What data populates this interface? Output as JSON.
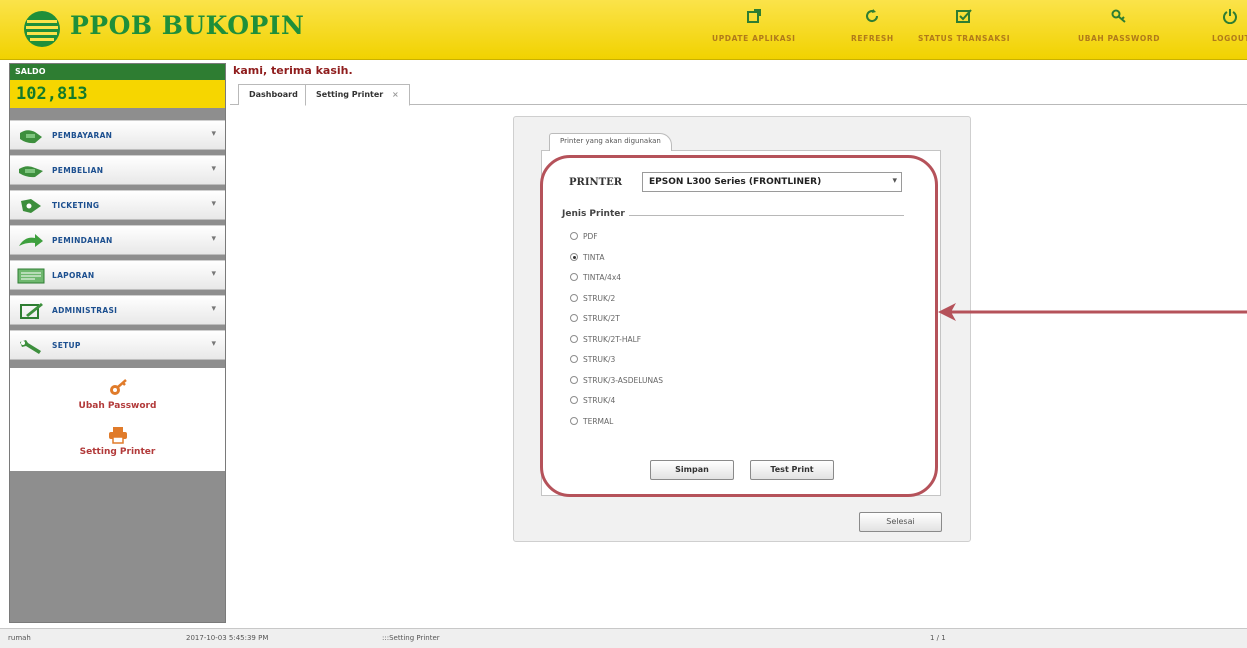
{
  "header": {
    "brand": "PPOB BUKOPIN",
    "brand_color": "#1f8f3a",
    "nav": [
      {
        "label": "UPDATE APLIKASI",
        "icon": "update-icon"
      },
      {
        "label": "REFRESH",
        "icon": "refresh-icon"
      },
      {
        "label": "STATUS TRANSAKSI",
        "icon": "status-check-icon"
      },
      {
        "label": "UBAH PASSWORD",
        "icon": "key-icon"
      },
      {
        "label": "LOGOUT",
        "icon": "power-icon"
      }
    ]
  },
  "sidebar": {
    "saldo_label": "SALDO",
    "saldo_value": "102,813",
    "menu": [
      {
        "label": "PEMBAYARAN",
        "icon": "payment-icon"
      },
      {
        "label": "PEMBELIAN",
        "icon": "purchase-icon"
      },
      {
        "label": "TICKETING",
        "icon": "ticket-icon"
      },
      {
        "label": "PEMINDAHAN",
        "icon": "transfer-icon"
      },
      {
        "label": "LAPORAN",
        "icon": "report-icon"
      },
      {
        "label": "ADMINISTRASI",
        "icon": "admin-icon"
      },
      {
        "label": "SETUP",
        "icon": "wrench-icon"
      }
    ],
    "setup_items": [
      {
        "label": "Ubah Password",
        "icon": "key-icon"
      },
      {
        "label": "Setting Printer",
        "icon": "printer-icon"
      }
    ]
  },
  "main": {
    "welcome_text": "kami, terima kasih.",
    "tabs": [
      {
        "label": "Dashboard",
        "active": false
      },
      {
        "label": "Setting Printer",
        "active": true,
        "close": "×"
      }
    ]
  },
  "printer_dialog": {
    "fieldset_title": "Printer yang akan digunakan",
    "printer_label": "PRINTER",
    "printer_selected": "EPSON L300 Series (FRONTLINER)",
    "jenis_label": "Jenis Printer",
    "options": [
      "PDF",
      "TINTA",
      "TINTA/4x4",
      "STRUK/2",
      "STRUK/2T",
      "STRUK/2T-HALF",
      "STRUK/3",
      "STRUK/3-ASDELUNAS",
      "STRUK/4",
      "TERMAL"
    ],
    "selected_option": "TINTA",
    "simpan_label": "Simpan",
    "test_print_label": "Test Print",
    "selesai_label": "Selesai"
  },
  "status_bar": {
    "user": "rumah",
    "datetime": "2017-10-03 5:45:39 PM",
    "path": ":::Setting Printer",
    "page": "1 / 1"
  },
  "colors": {
    "header_yellow": "#f6d600",
    "highlight_red": "#b5525a",
    "sidebar_gray": "#8e8e8e"
  }
}
